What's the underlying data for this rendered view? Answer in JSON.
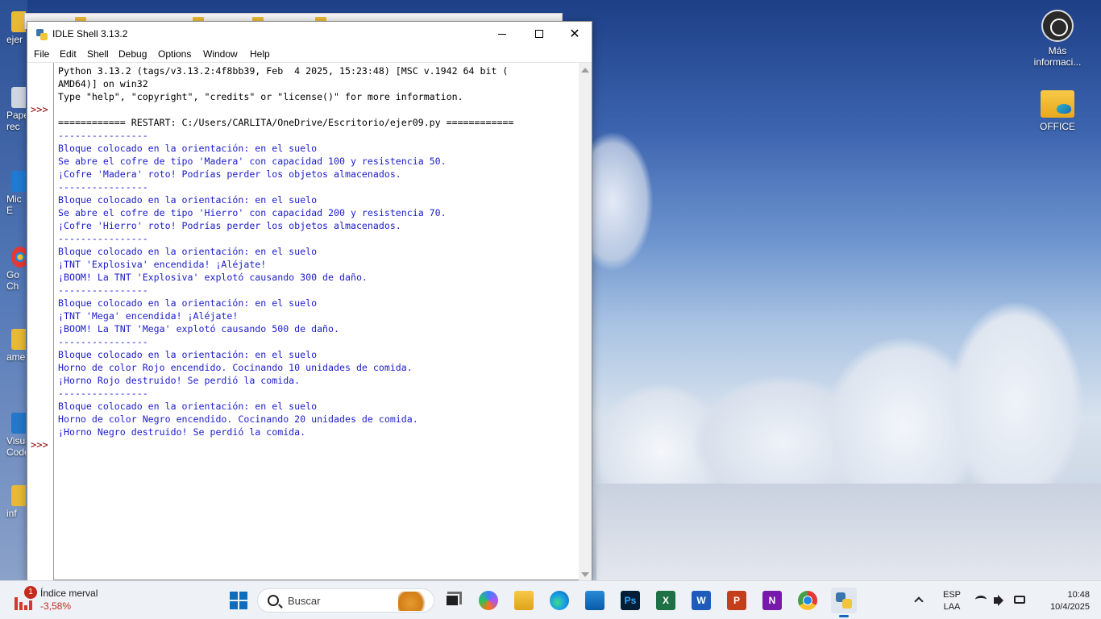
{
  "desktop": {
    "icons_right": [
      {
        "label": "Más\ninformaci..."
      },
      {
        "label": "OFFICE"
      }
    ],
    "icons_left_partial": [
      "ejer",
      "Pape\nrec",
      "Mic\nE",
      "Go\nCh",
      "ame",
      "Visua\nCode",
      "inf"
    ]
  },
  "idle": {
    "title": "IDLE Shell 3.13.2",
    "menu": [
      "File",
      "Edit",
      "Shell",
      "Debug",
      "Options",
      "Window",
      "Help"
    ],
    "prompt_symbol": ">>>",
    "lines": [
      {
        "text": "Python 3.13.2 (tags/v3.13.2:4f8bb39, Feb  4 2025, 15:23:48) [MSC v.1942 64 bit (",
        "color": "black"
      },
      {
        "text": "AMD64)] on win32",
        "color": "black"
      },
      {
        "text": "Type \"help\", \"copyright\", \"credits\" or \"license()\" for more information.",
        "color": "black"
      },
      {
        "text": "",
        "color": "black"
      },
      {
        "text": "============ RESTART: C:/Users/CARLITA/OneDrive/Escritorio/ejer09.py ============",
        "color": "black"
      },
      {
        "text": "----------------",
        "color": "blue"
      },
      {
        "text": "Bloque colocado en la orientación: en el suelo",
        "color": "blue"
      },
      {
        "text": "Se abre el cofre de tipo 'Madera' con capacidad 100 y resistencia 50.",
        "color": "blue"
      },
      {
        "text": "¡Cofre 'Madera' roto! Podrías perder los objetos almacenados.",
        "color": "blue"
      },
      {
        "text": "----------------",
        "color": "blue"
      },
      {
        "text": "Bloque colocado en la orientación: en el suelo",
        "color": "blue"
      },
      {
        "text": "Se abre el cofre de tipo 'Hierro' con capacidad 200 y resistencia 70.",
        "color": "blue"
      },
      {
        "text": "¡Cofre 'Hierro' roto! Podrías perder los objetos almacenados.",
        "color": "blue"
      },
      {
        "text": "----------------",
        "color": "blue"
      },
      {
        "text": "Bloque colocado en la orientación: en el suelo",
        "color": "blue"
      },
      {
        "text": "¡TNT 'Explosiva' encendida! ¡Aléjate!",
        "color": "blue"
      },
      {
        "text": "¡BOOM! La TNT 'Explosiva' explotó causando 300 de daño.",
        "color": "blue"
      },
      {
        "text": "----------------",
        "color": "blue"
      },
      {
        "text": "Bloque colocado en la orientación: en el suelo",
        "color": "blue"
      },
      {
        "text": "¡TNT 'Mega' encendida! ¡Aléjate!",
        "color": "blue"
      },
      {
        "text": "¡BOOM! La TNT 'Mega' explotó causando 500 de daño.",
        "color": "blue"
      },
      {
        "text": "----------------",
        "color": "blue"
      },
      {
        "text": "Bloque colocado en la orientación: en el suelo",
        "color": "blue"
      },
      {
        "text": "Horno de color Rojo encendido. Cocinando 10 unidades de comida.",
        "color": "blue"
      },
      {
        "text": "¡Horno Rojo destruido! Se perdió la comida.",
        "color": "blue"
      },
      {
        "text": "----------------",
        "color": "blue"
      },
      {
        "text": "Bloque colocado en la orientación: en el suelo",
        "color": "blue"
      },
      {
        "text": "Horno de color Negro encendido. Cocinando 20 unidades de comida.",
        "color": "blue"
      },
      {
        "text": "¡Horno Negro destruido! Se perdió la comida.",
        "color": "blue"
      }
    ],
    "colors": {
      "output_blue": "#1c1cc9",
      "prompt_red": "#8b0000"
    }
  },
  "taskbar": {
    "widget": {
      "badge": "1",
      "title": "Índice merval",
      "value": "-3,58%"
    },
    "search_placeholder": "Buscar",
    "apps": [
      "start-icon",
      "task-view-icon",
      "copilot-icon",
      "file-explorer-icon",
      "edge-icon",
      "store-icon",
      "photoshop-icon",
      "excel-icon",
      "word-icon",
      "powerpoint-icon",
      "onenote-icon",
      "chrome-icon",
      "python-idle-icon"
    ],
    "app_letters": {
      "photoshop": "Ps",
      "excel": "X",
      "word": "W",
      "powerpoint": "P",
      "onenote": "N"
    },
    "language": {
      "line1": "ESP",
      "line2": "LAA"
    },
    "clock": {
      "time": "10:48",
      "date": "10/4/2025"
    }
  }
}
